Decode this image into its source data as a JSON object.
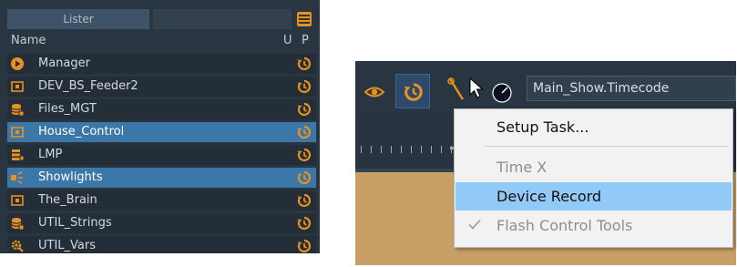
{
  "lister": {
    "title": "Lister",
    "columns": {
      "name": "Name",
      "u": "U",
      "p": "P"
    },
    "rows": [
      {
        "label": "Manager",
        "icon": "play-circle-icon",
        "selected": false
      },
      {
        "label": "DEV_BS_Feeder2",
        "icon": "device-icon",
        "selected": false
      },
      {
        "label": "Files_MGT",
        "icon": "database-icon",
        "selected": false
      },
      {
        "label": "House_Control",
        "icon": "device-icon",
        "selected": true
      },
      {
        "label": "LMP",
        "icon": "light-rack-icon",
        "selected": false
      },
      {
        "label": "Showlights",
        "icon": "spotlight-icon",
        "selected": true
      },
      {
        "label": "The_Brain",
        "icon": "device-icon",
        "selected": false
      },
      {
        "label": "UTIL_Strings",
        "icon": "database-icon",
        "selected": false
      },
      {
        "label": "UTIL_Vars",
        "icon": "gear-tool-icon",
        "selected": false
      }
    ]
  },
  "toolbar": {
    "timecode_value": "Main_Show.Timecode",
    "icons": [
      "eye-icon",
      "history-icon",
      "wrench-icon",
      "cursor-icon",
      "knob-icon"
    ]
  },
  "context_menu": {
    "items": [
      {
        "label": "Setup Task...",
        "state": "normal"
      },
      {
        "label": "Time X",
        "state": "disabled"
      },
      {
        "label": "Device Record",
        "state": "highlighted"
      },
      {
        "label": "Flash Control Tools",
        "state": "disabled-checked"
      }
    ]
  },
  "colors": {
    "panel_bg": "#2a3542",
    "row_bg": "#232e39",
    "row_selected": "#3c77a9",
    "accent_orange": "#e8911e",
    "menu_highlight": "#91c9f7",
    "track": "#c8a066"
  }
}
